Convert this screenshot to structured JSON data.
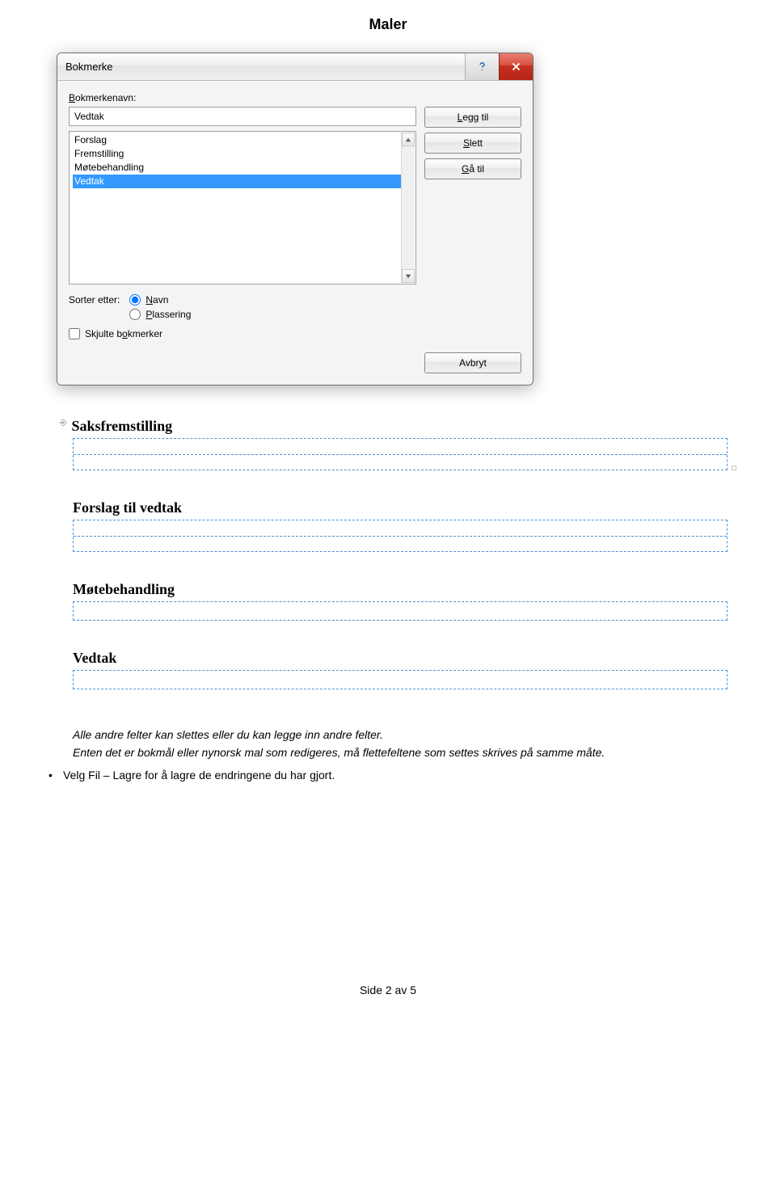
{
  "page_title": "Maler",
  "dialog": {
    "title": "Bokmerke",
    "label_bookmark_name": "Bokmerkenavn:",
    "input_value": "Vedtak",
    "list_items": [
      "Forslag",
      "Fremstilling",
      "Møtebehandling",
      "Vedtak"
    ],
    "selected_index": 3,
    "buttons": {
      "add": "Legg til",
      "delete": "Slett",
      "goto": "Gå til",
      "cancel": "Avbryt"
    },
    "sort_label": "Sorter etter:",
    "radio_name": "Navn",
    "radio_location": "Plassering",
    "checkbox_hidden": "Skjulte bokmerker"
  },
  "sections": {
    "s1": "Saksfremstilling",
    "s2": "Forslag til vedtak",
    "s3": "Møtebehandling",
    "s4": "Vedtak"
  },
  "body": {
    "p1": "Alle andre felter kan slettes eller du kan legge inn andre felter.",
    "p2": "Enten det er bokmål eller nynorsk mal som redigeres, må flettefeltene som settes skrives på samme måte.",
    "bullet": "Velg Fil – Lagre for å lagre de endringene du har gjort."
  },
  "footer": "Side 2 av 5"
}
